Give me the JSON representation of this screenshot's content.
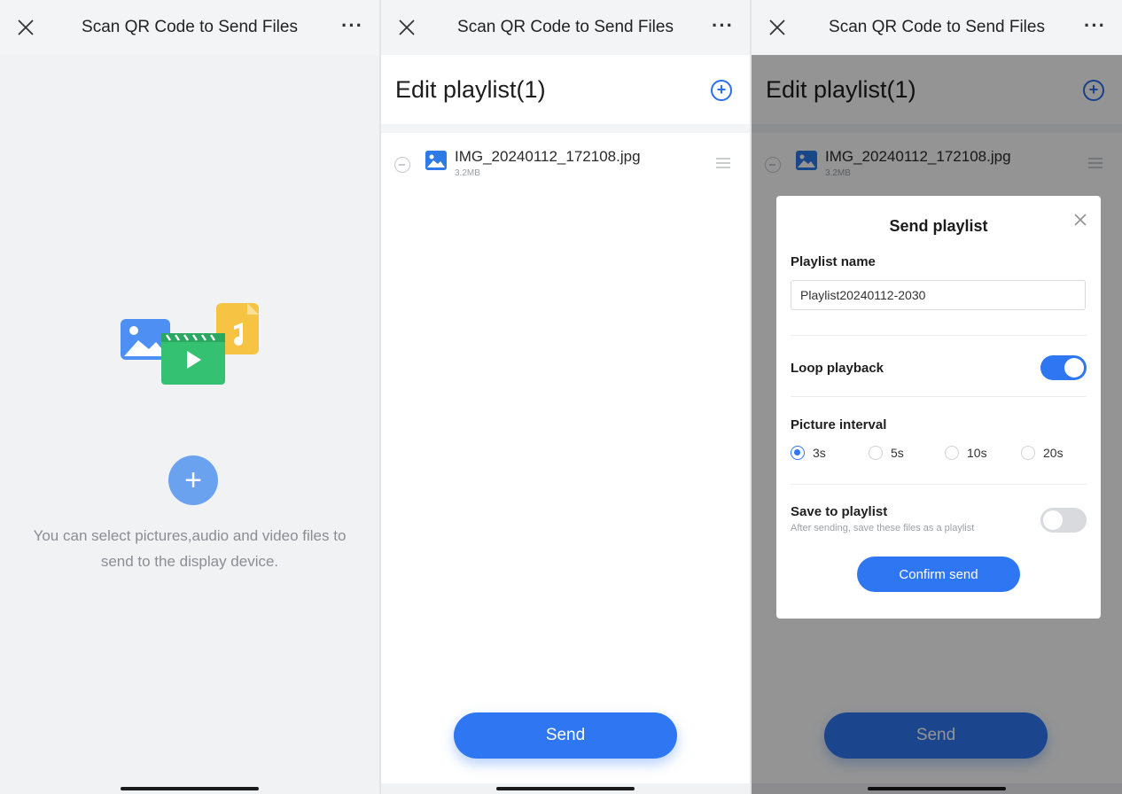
{
  "screens": [
    {
      "nav": {
        "title": "Scan QR Code to Send Files",
        "more": "···"
      },
      "hint": "You can select pictures,audio and video files to send to the display device.",
      "add_symbol": "+"
    },
    {
      "nav": {
        "title": "Scan QR Code to Send Files",
        "more": "···"
      },
      "edit_title": "Edit playlist(1)",
      "add_symbol": "+",
      "file": {
        "name": "IMG_20240112_172108.jpg",
        "size": "3.2MB"
      },
      "send_label": "Send"
    },
    {
      "nav": {
        "title": "Scan QR Code to Send Files",
        "more": "···"
      },
      "edit_title": "Edit playlist(1)",
      "add_symbol": "+",
      "file": {
        "name": "IMG_20240112_172108.jpg",
        "size": "3.2MB"
      },
      "send_label": "Send",
      "dialog": {
        "title": "Send playlist",
        "name_label": "Playlist name",
        "name_value": "Playlist20240112-2030",
        "loop_label": "Loop playback",
        "loop_on": true,
        "interval_label": "Picture interval",
        "interval_options": [
          "3s",
          "5s",
          "10s",
          "20s"
        ],
        "interval_selected": "3s",
        "save_label": "Save to playlist",
        "save_sublabel": "After sending, save these files as a playlist",
        "save_on": false,
        "confirm_label": "Confirm send"
      }
    }
  ],
  "colors": {
    "accent": "#2f77f2",
    "muted_text": "#8a8d93",
    "overlay": "rgba(0,0,0,0.42)"
  },
  "icons": [
    "close-icon",
    "more-icon",
    "media-files-icon",
    "add-circle-icon",
    "remove-circle-icon",
    "image-file-icon",
    "drag-handle-icon",
    "radio-icon",
    "toggle-switch"
  ]
}
